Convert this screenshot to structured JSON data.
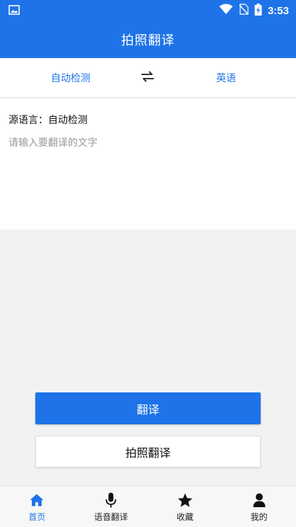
{
  "status_bar": {
    "time": "3:53"
  },
  "app_bar": {
    "title": "拍照翻译"
  },
  "language_bar": {
    "source": "自动检测",
    "target": "英语"
  },
  "input": {
    "source_label": "源语言：自动检测",
    "placeholder": "请输入要翻译的文字",
    "value": ""
  },
  "actions": {
    "translate": "翻译",
    "photo_translate": "拍照翻译"
  },
  "bottom_nav": {
    "items": [
      {
        "label": "首页",
        "icon": "home-icon",
        "active": true
      },
      {
        "label": "语音翻译",
        "icon": "microphone-icon",
        "active": false
      },
      {
        "label": "收藏",
        "icon": "star-icon",
        "active": false
      },
      {
        "label": "我的",
        "icon": "person-icon",
        "active": false
      }
    ]
  },
  "colors": {
    "accent": "#1e73e8",
    "background": "#f2f2f2",
    "surface": "#ffffff"
  }
}
